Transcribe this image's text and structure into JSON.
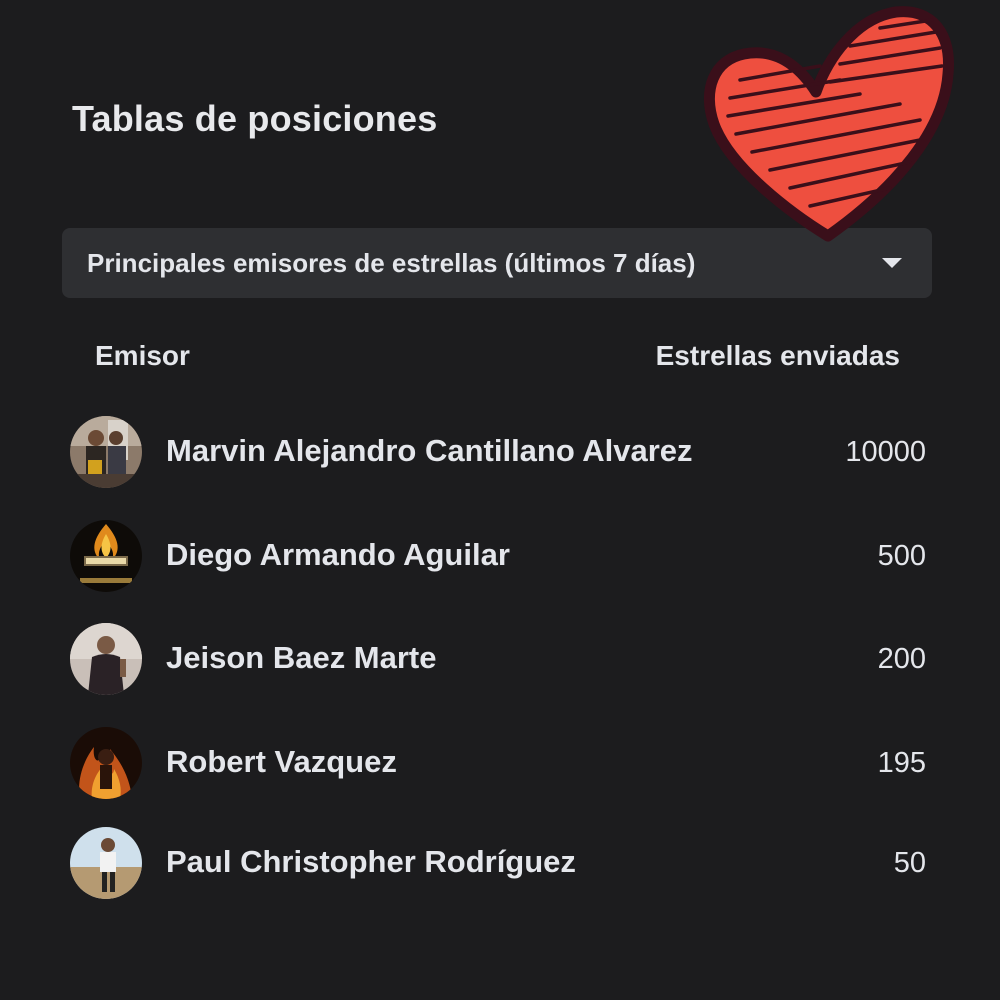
{
  "header": {
    "title": "Tablas de posiciones"
  },
  "filter": {
    "selected": "Principales emisores de estrellas (últimos 7 días)"
  },
  "table": {
    "columns": [
      "Emisor",
      "Estrellas enviadas"
    ],
    "rows": [
      {
        "name": "Marvin Alejandro Cantillano Alvarez",
        "stars": "10000"
      },
      {
        "name": "Diego Armando Aguilar",
        "stars": "500"
      },
      {
        "name": "Jeison Baez Marte",
        "stars": "200"
      },
      {
        "name": "Robert Vazquez",
        "stars": "195"
      },
      {
        "name": "Paul Christopher Rodríguez",
        "stars": "50"
      }
    ]
  },
  "decoration": {
    "sticker": "heart-icon",
    "sticker_color": "#ee4f3f"
  },
  "colors": {
    "background": "#1c1c1e",
    "dropdown_background": "#2e2f32",
    "text": "#e4e6eb"
  }
}
